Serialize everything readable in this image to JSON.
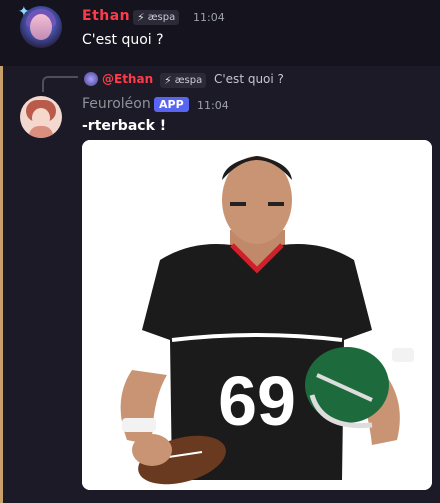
{
  "messages": [
    {
      "author": "Ethan",
      "role_badge": "æspa",
      "time": "11:04",
      "text": "C'est quoi ?"
    },
    {
      "reply": {
        "author": "@Ethan",
        "role_badge": "æspa",
        "text": "C'est quoi ?"
      },
      "author": "Feuroléon",
      "app_badge": "APP",
      "time": "11:04",
      "text": "-rterback !",
      "image": {
        "jersey_number": "69"
      }
    }
  ],
  "colors": {
    "background": "#16141f",
    "username_red": "#ff3b4a",
    "app_badge": "#5865f2",
    "reply_accent": "#c9a06a"
  }
}
